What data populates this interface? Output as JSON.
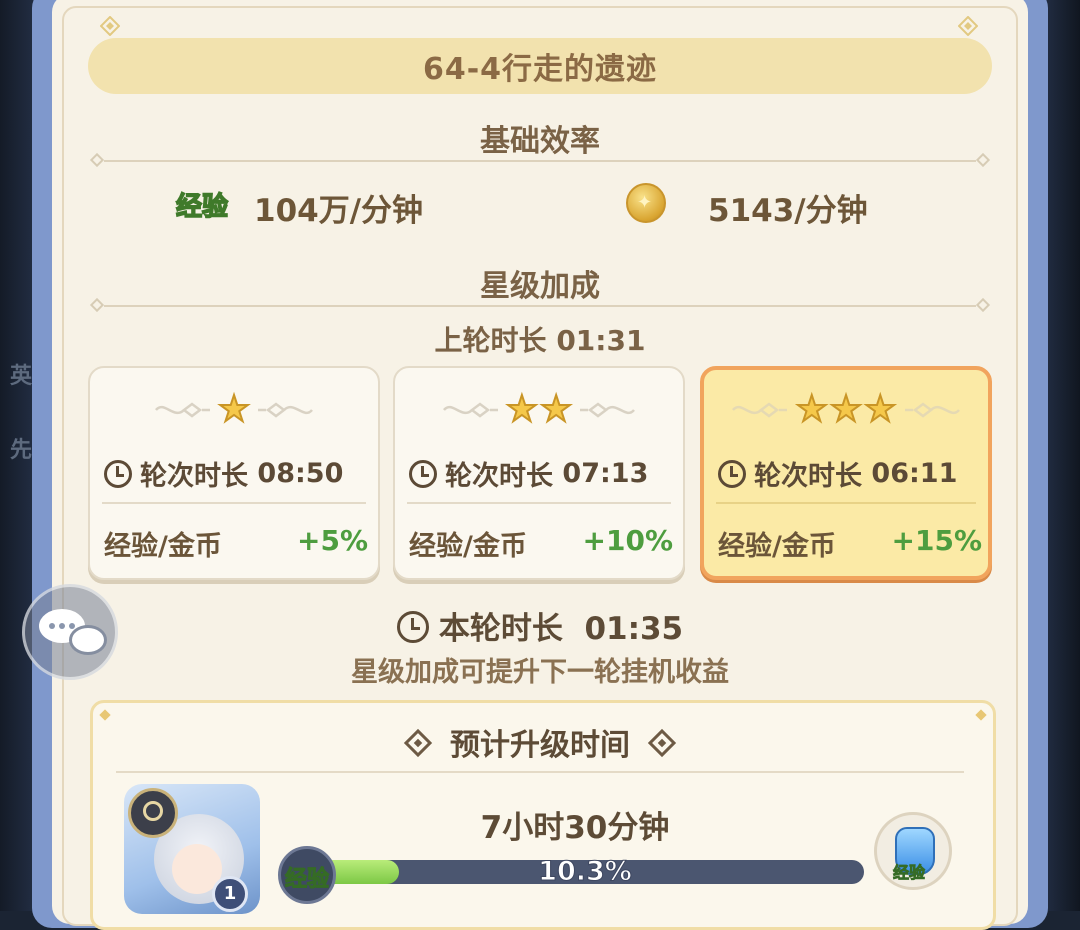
{
  "stage": {
    "title": "64-4行走的遗迹"
  },
  "base": {
    "heading": "基础效率",
    "xp_label": "经验",
    "xp_rate": "104万/分钟",
    "gold_rate": "5143/分钟"
  },
  "star_bonus": {
    "heading": "星级加成",
    "last_round_label": "上轮时长",
    "last_round_value": "01:31",
    "cards": [
      {
        "stars": 1,
        "duration_label": "轮次时长",
        "duration": "08:50",
        "reward_label": "经验/金币",
        "bonus": "+5%",
        "active": false
      },
      {
        "stars": 2,
        "duration_label": "轮次时长",
        "duration": "07:13",
        "reward_label": "经验/金币",
        "bonus": "+10%",
        "active": false
      },
      {
        "stars": 3,
        "duration_label": "轮次时长",
        "duration": "06:11",
        "reward_label": "经验/金币",
        "bonus": "+15%",
        "active": true
      }
    ],
    "current_round_label": "本轮时长",
    "current_round_value": "01:35",
    "hint": "星级加成可提升下一轮挂机收益"
  },
  "levelup": {
    "heading": "预计升级时间",
    "eta": "7小时30分钟",
    "progress_percent": 10.3,
    "progress_text": "10.3%",
    "xp_badge": "经验",
    "potion_label": "经验",
    "hero_level": "1"
  },
  "colors": {
    "frame": "#7f98cc",
    "panel": "#f7f2e6",
    "title_bar": "#f2e2ae",
    "active_border": "#f1a45d",
    "bonus_green": "#4e9d3f"
  }
}
